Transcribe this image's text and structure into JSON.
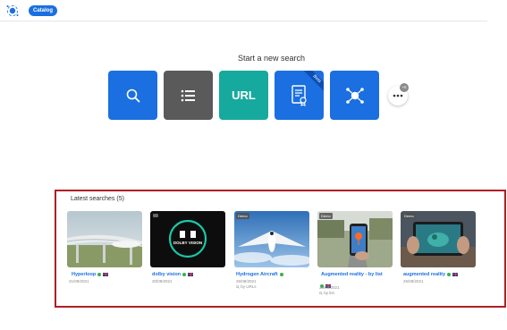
{
  "header": {
    "pill_label": "Catalog",
    "logo_icon": "app-logo-icon"
  },
  "search": {
    "title": "Start a new search",
    "tiles": [
      {
        "name": "search-tile",
        "icon": "search-icon",
        "color": "#1b6fe0"
      },
      {
        "name": "list-tile",
        "icon": "list-icon",
        "color": "#5a5a5a"
      },
      {
        "name": "url-tile",
        "label": "URL",
        "color": "#16a99e"
      },
      {
        "name": "patent-tile",
        "icon": "document-certificate-icon",
        "color": "#1b6fe0",
        "badge": "Beta"
      },
      {
        "name": "network-tile",
        "icon": "network-icon",
        "color": "#1b6fe0"
      }
    ],
    "more_badge": "+5"
  },
  "latest": {
    "title": "Latest searches (5)",
    "cards": [
      {
        "title": "Hyperloop",
        "date": "21/09/2021",
        "subtitle": "",
        "tag": ""
      },
      {
        "title": "dolby vision",
        "date": "20/09/2021",
        "subtitle": "",
        "tag": ""
      },
      {
        "title": "Hydrogen Aircraft",
        "date": "26/08/2021",
        "subtitle": "by URLs",
        "tag": "Demo"
      },
      {
        "title": "Augmented reality - by list",
        "date": "30/08/2021",
        "subtitle": "by list",
        "tag": "Demo"
      },
      {
        "title": "augmented reality",
        "date": "25/08/2021",
        "subtitle": "",
        "tag": "Demo"
      }
    ],
    "dolby_logo": "DOLBY VISION"
  },
  "colors": {
    "accent": "#1b6fe0",
    "teal": "#16a99e",
    "highlight_frame": "#b01e23",
    "status_green": "#36b34a"
  }
}
